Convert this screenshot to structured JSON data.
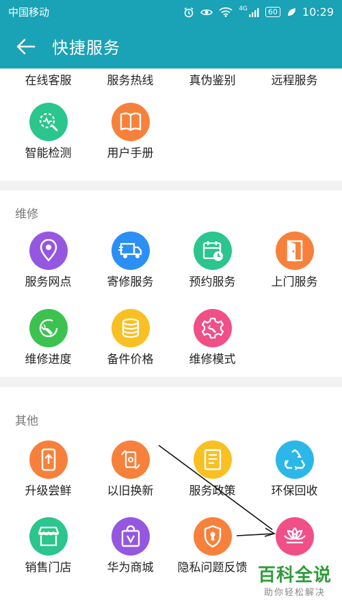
{
  "status": {
    "carrier": "中国移动",
    "signal_label": "4G",
    "battery": "60",
    "time": "10:29"
  },
  "header": {
    "title": "快捷服务",
    "back_icon": "back-arrow-icon"
  },
  "sections": {
    "service": {
      "row1": [
        "在线客服",
        "服务热线",
        "真伪鉴别",
        "远程服务"
      ],
      "items": [
        {
          "label": "智能检测",
          "icon": "smart-detect-icon",
          "color": "#2bc58e"
        },
        {
          "label": "用户手册",
          "icon": "manual-book-icon",
          "color": "#f7813b"
        }
      ]
    },
    "repair": {
      "title": "维修",
      "items": [
        {
          "label": "服务网点",
          "icon": "location-pin-icon",
          "color": "#9557e0"
        },
        {
          "label": "寄修服务",
          "icon": "delivery-truck-icon",
          "color": "#2b8ff3"
        },
        {
          "label": "预约服务",
          "icon": "calendar-clock-icon",
          "color": "#2bc58e"
        },
        {
          "label": "上门服务",
          "icon": "door-icon",
          "color": "#f7813b"
        },
        {
          "label": "维修进度",
          "icon": "wrench-progress-icon",
          "color": "#3cc24f"
        },
        {
          "label": "备件价格",
          "icon": "coin-stack-icon",
          "color": "#f9c023"
        },
        {
          "label": "维修模式",
          "icon": "gear-wrench-icon",
          "color": "#f04f88"
        }
      ]
    },
    "other": {
      "title": "其他",
      "items": [
        {
          "label": "升级尝鲜",
          "icon": "phone-upgrade-icon",
          "color": "#f7813b"
        },
        {
          "label": "以旧换新",
          "icon": "trade-in-phone-icon",
          "color": "#f7813b"
        },
        {
          "label": "服务政策",
          "icon": "document-icon",
          "color": "#f9c023"
        },
        {
          "label": "环保回收",
          "icon": "recycle-icon",
          "color": "#2bb7e8"
        },
        {
          "label": "销售门店",
          "icon": "store-icon",
          "color": "#2bc58e"
        },
        {
          "label": "华为商城",
          "icon": "shopping-bag-icon",
          "color": "#9557e0"
        },
        {
          "label": "隐私问题反馈",
          "icon": "shield-keyhole-icon",
          "color": "#f7813b"
        },
        {
          "label": "",
          "icon": "lotus-icon",
          "color": "#f04f88"
        }
      ]
    }
  },
  "watermark": {
    "main": "百科全说",
    "sub": "助你轻松解决"
  }
}
